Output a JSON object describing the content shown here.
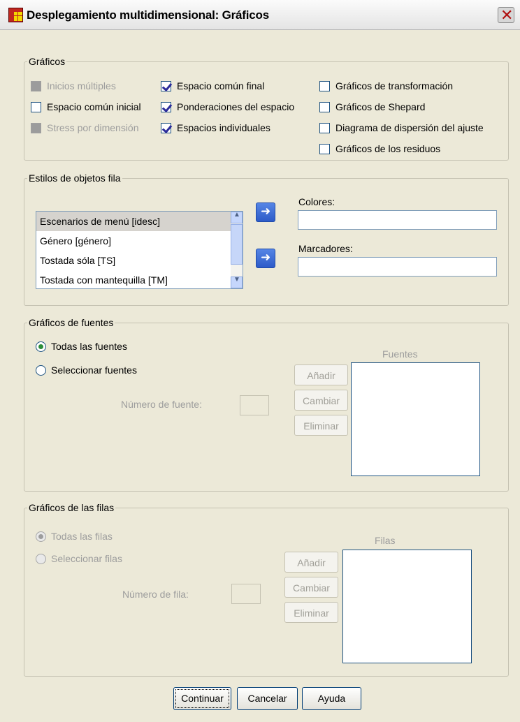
{
  "window": {
    "title": "Desplegamiento multidimensional: Gráficos"
  },
  "graficos": {
    "legend": "Gráficos",
    "col1": [
      {
        "label": "Inicios múltiples",
        "checked": false,
        "enabled": false
      },
      {
        "label": "Espacio común inicial",
        "checked": false,
        "enabled": true
      },
      {
        "label": "Stress por dimensión",
        "checked": false,
        "enabled": false
      }
    ],
    "col2": [
      {
        "label": "Espacio común final",
        "checked": true,
        "enabled": true
      },
      {
        "label": "Ponderaciones del espacio",
        "checked": true,
        "enabled": true
      },
      {
        "label": "Espacios individuales",
        "checked": true,
        "enabled": true
      }
    ],
    "col3": [
      {
        "label": "Gráficos de transformación",
        "checked": false,
        "enabled": true
      },
      {
        "label": "Gráficos de Shepard",
        "checked": false,
        "enabled": true
      },
      {
        "label": "Diagrama de dispersión del ajuste",
        "checked": false,
        "enabled": true
      },
      {
        "label": "Gráficos de los residuos",
        "checked": false,
        "enabled": true
      }
    ]
  },
  "estilos": {
    "legend": "Estilos de objetos fila",
    "variables": [
      "Escenarios de menú [idesc]",
      "Género [género]",
      "Tostada sóla [TS]",
      "Tostada con mantequilla [TM]"
    ],
    "colores_label": "Colores:",
    "colores_value": "",
    "marcadores_label": "Marcadores:",
    "marcadores_value": ""
  },
  "fuentes": {
    "legend": "Gráficos de fuentes",
    "radio_all": "Todas las fuentes",
    "radio_select": "Seleccionar fuentes",
    "numero_label": "Número de fuente:",
    "box_label": "Fuentes",
    "add": "Añadir",
    "change": "Cambiar",
    "remove": "Eliminar"
  },
  "filas": {
    "legend": "Gráficos de las filas",
    "radio_all": "Todas las filas",
    "radio_select": "Seleccionar filas",
    "numero_label": "Número de fila:",
    "box_label": "Filas",
    "add": "Añadir",
    "change": "Cambiar",
    "remove": "Eliminar"
  },
  "buttons": {
    "continue": "Continuar",
    "cancel": "Cancelar",
    "help": "Ayuda"
  }
}
